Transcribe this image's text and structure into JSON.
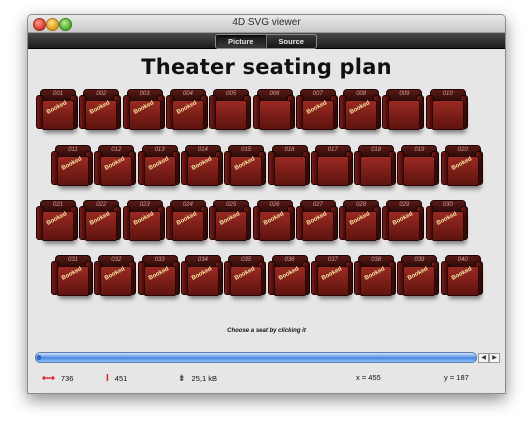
{
  "window": {
    "title": "4D SVG viewer"
  },
  "toolbar": {
    "tabs": [
      {
        "label": "Picture",
        "active": true
      },
      {
        "label": "Source",
        "active": false
      }
    ]
  },
  "plan": {
    "title": "Theater seating plan",
    "hint": "Choose a seat by clicking it",
    "booked_label": "Booked",
    "rows": [
      {
        "seats": [
          {
            "num": "001",
            "booked": true
          },
          {
            "num": "002",
            "booked": true
          },
          {
            "num": "003",
            "booked": true
          },
          {
            "num": "004",
            "booked": true
          },
          {
            "num": "005",
            "booked": false
          },
          {
            "num": "006",
            "booked": false
          },
          {
            "num": "007",
            "booked": true
          },
          {
            "num": "008",
            "booked": true
          },
          {
            "num": "009",
            "booked": false
          },
          {
            "num": "010",
            "booked": false
          }
        ]
      },
      {
        "seats": [
          {
            "num": "011",
            "booked": true
          },
          {
            "num": "012",
            "booked": true
          },
          {
            "num": "013",
            "booked": true
          },
          {
            "num": "014",
            "booked": true
          },
          {
            "num": "015",
            "booked": true
          },
          {
            "num": "016",
            "booked": false
          },
          {
            "num": "017",
            "booked": false
          },
          {
            "num": "018",
            "booked": false
          },
          {
            "num": "019",
            "booked": false
          },
          {
            "num": "020",
            "booked": true
          }
        ]
      },
      {
        "seats": [
          {
            "num": "021",
            "booked": true
          },
          {
            "num": "022",
            "booked": true
          },
          {
            "num": "023",
            "booked": true
          },
          {
            "num": "024",
            "booked": true
          },
          {
            "num": "025",
            "booked": true
          },
          {
            "num": "026",
            "booked": true
          },
          {
            "num": "027",
            "booked": true
          },
          {
            "num": "028",
            "booked": true
          },
          {
            "num": "029",
            "booked": true
          },
          {
            "num": "030",
            "booked": true
          }
        ]
      },
      {
        "seats": [
          {
            "num": "031",
            "booked": true
          },
          {
            "num": "032",
            "booked": true
          },
          {
            "num": "033",
            "booked": true
          },
          {
            "num": "034",
            "booked": true
          },
          {
            "num": "035",
            "booked": true
          },
          {
            "num": "036",
            "booked": true
          },
          {
            "num": "037",
            "booked": true
          },
          {
            "num": "038",
            "booked": true
          },
          {
            "num": "039",
            "booked": true
          },
          {
            "num": "040",
            "booked": true
          }
        ]
      }
    ]
  },
  "status": {
    "width": "736",
    "height": "451",
    "size": "25,1 kB",
    "x": "x = 455",
    "y": "y = 187"
  },
  "colors": {
    "seat": "#8a231c",
    "booked_text": "#f6e6a0",
    "scrollbar": "#4b8ae0",
    "dimension_icons": "#d7231c"
  }
}
